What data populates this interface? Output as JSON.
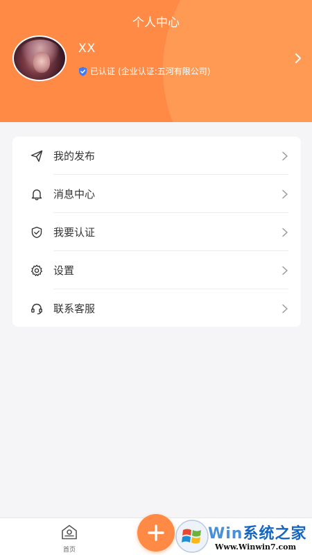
{
  "header": {
    "title": "个人中心",
    "username": "XX",
    "verified_text": "已认证",
    "company_text": "(企业认证:五河有限公司)"
  },
  "menu": [
    {
      "label": "我的发布",
      "icon": "send-icon"
    },
    {
      "label": "消息中心",
      "icon": "bell-icon"
    },
    {
      "label": "我要认证",
      "icon": "shield-check-icon"
    },
    {
      "label": "设置",
      "icon": "gear-icon"
    },
    {
      "label": "联系客服",
      "icon": "headset-icon"
    }
  ],
  "tabbar": {
    "home_label": "首页",
    "add_icon": "plus-icon"
  },
  "watermark": {
    "brand_prefix": "Win",
    "brand_suffix": "系统之家",
    "url": "Www.Winwin7.com"
  },
  "colors": {
    "accent": "#fe8a45",
    "background": "#f5f5f7",
    "card": "#ffffff"
  }
}
